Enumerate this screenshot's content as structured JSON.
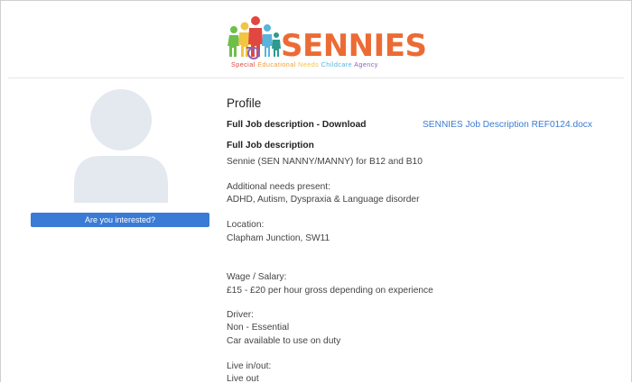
{
  "header": {
    "logo_text": "SENNIES",
    "tagline": {
      "word1": "Special",
      "word2": "Educational",
      "word3": "Needs",
      "word4": "Childcare",
      "word5": "Agency"
    }
  },
  "sidebar": {
    "interest_button": "Are you interested?"
  },
  "profile": {
    "title": "Profile",
    "download_label": "Full Job description - Download",
    "download_link": "SENNIES Job Description REF0124.docx",
    "job_desc_heading": "Full Job description",
    "job_desc_value": "Sennie (SEN NANNY/MANNY) for B12 and B10",
    "needs_label": "Additional needs present:",
    "needs_value": "ADHD, Autism, Dyspraxia & Language disorder",
    "location_label": "Location:",
    "location_value": "Clapham Junction, SW11",
    "wage_label": "Wage / Salary:",
    "wage_value": "£15 - £20 per hour gross depending on experience",
    "driver_label": "Driver:",
    "driver_value": "Non - Essential",
    "driver_note": "Car available to use on duty",
    "live_label": "Live in/out:",
    "live_value": "Live out"
  },
  "colors": {
    "brand_orange": "#ec6b35",
    "button_blue": "#3a7bd5",
    "link_blue": "#3a7bd5",
    "avatar_grey": "#e4e8ef"
  }
}
